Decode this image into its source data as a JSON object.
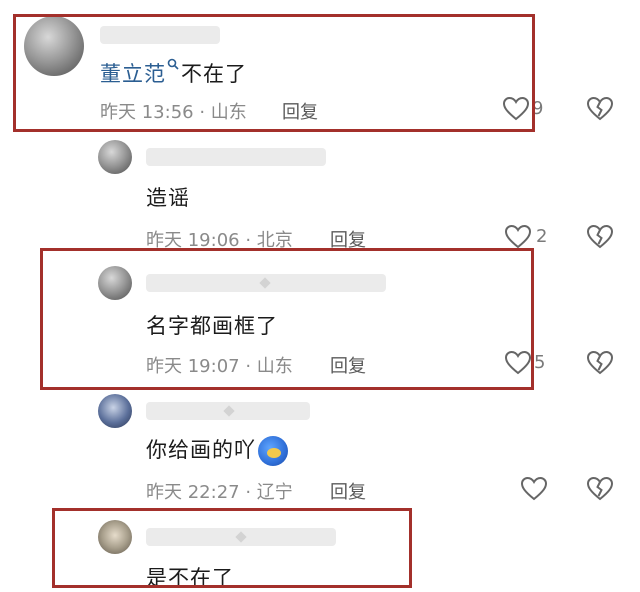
{
  "comments": [
    {
      "text_prefix_name": "董立范",
      "text_suffix": "不在了",
      "time": "昨天 13:56 · 山东",
      "reply": "回复",
      "likes": "9"
    },
    {
      "text": "造谣",
      "time": "昨天 19:06 · 北京",
      "reply": "回复",
      "likes": "2"
    },
    {
      "text": "名字都画框了",
      "time": "昨天 19:07 · 山东",
      "reply": "回复",
      "likes": "5"
    },
    {
      "text": "你给画的吖",
      "time": "昨天 22:27 · 辽宁",
      "reply": "回复",
      "likes": ""
    },
    {
      "text": "是不在了",
      "time": "",
      "reply": "",
      "likes": ""
    }
  ],
  "colors": {
    "frame": "#a3302b",
    "name_link": "#2b5e92"
  },
  "icons": {
    "like": "heart-outline-icon",
    "dislike": "broken-heart-icon",
    "search": "search-icon"
  }
}
